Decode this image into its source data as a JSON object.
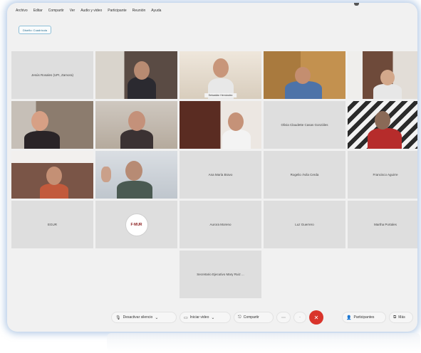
{
  "menu": [
    "Archivo",
    "Editar",
    "Compartir",
    "Ver",
    "Audio y video",
    "Participante",
    "Reunión",
    "Ayuda"
  ],
  "tag_label": "Diseño: Cuadrícula",
  "participants": [
    {
      "name": "Jesús Rosales (UPI, Zamora)",
      "video": false
    },
    {
      "name": "",
      "video": true
    },
    {
      "name": "Sebastián Hernández",
      "video": true,
      "active": true
    },
    {
      "name": "",
      "video": true
    },
    {
      "name": "",
      "video": true
    },
    {
      "name": "",
      "video": true
    },
    {
      "name": "",
      "video": true
    },
    {
      "name": "",
      "video": true
    },
    {
      "name": "Olivia Claudette Casas Gonzáles",
      "video": false
    },
    {
      "name": "",
      "video": true
    },
    {
      "name": "",
      "video": true
    },
    {
      "name": "",
      "video": true
    },
    {
      "name": "Ana María Bravo",
      "video": false
    },
    {
      "name": "Rogelio Ávila Cerda",
      "video": false
    },
    {
      "name": "Francisco Aguirre",
      "video": false
    },
    {
      "name": "EGUR",
      "video": false
    },
    {
      "name": "",
      "logo": "F·MUR"
    },
    {
      "name": "Aurora Moreno",
      "video": false
    },
    {
      "name": "Luz Guerrero",
      "video": false
    },
    {
      "name": "Martha Portales",
      "video": false
    },
    {
      "name": "Secretario Ejecutivo Mary Ruiz ...",
      "video": false
    }
  ],
  "toolbar": {
    "mute": "Desactivar silencio",
    "video": "Iniciar video",
    "share": "Compartir",
    "participants": "Participantes",
    "more": "Más"
  },
  "colors": {
    "accent": "#8ab9e0",
    "end_call": "#d9342b"
  }
}
